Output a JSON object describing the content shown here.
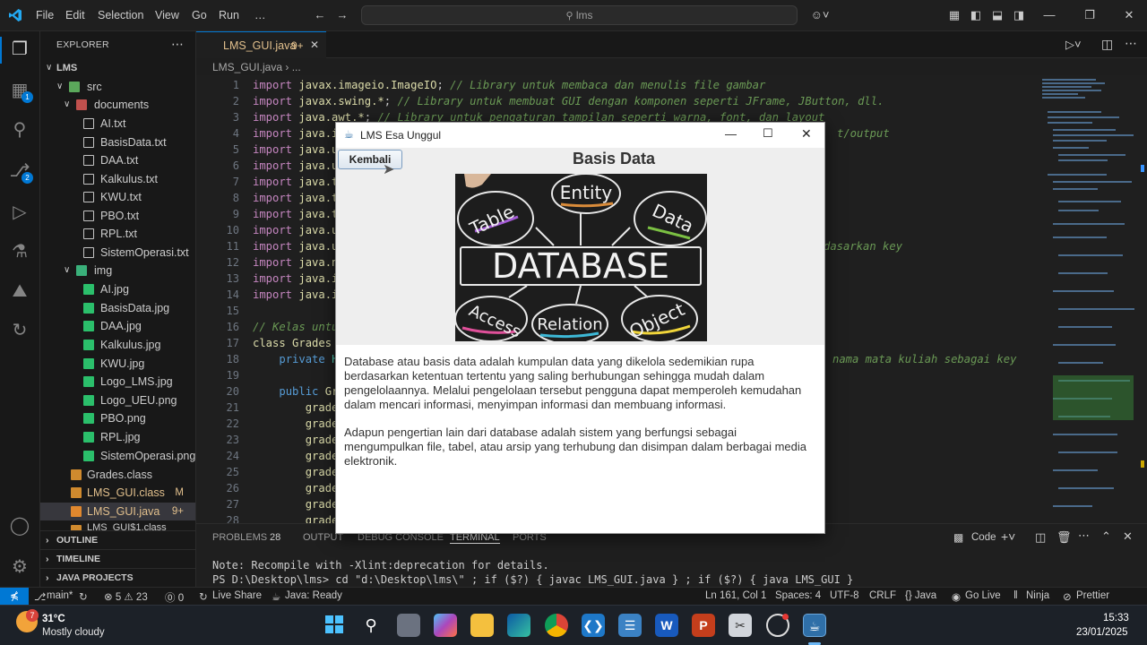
{
  "titlebar": {
    "menu": [
      "File",
      "Edit",
      "Selection",
      "View",
      "Go",
      "Run",
      "…"
    ],
    "search": "lms"
  },
  "sidebar": {
    "title": "EXPLORER",
    "root": "LMS",
    "src": "src",
    "documents": "documents",
    "doc_files": [
      "AI.txt",
      "BasisData.txt",
      "DAA.txt",
      "Kalkulus.txt",
      "KWU.txt",
      "PBO.txt",
      "RPL.txt",
      "SistemOperasi.txt"
    ],
    "img": "img",
    "img_files": [
      "AI.jpg",
      "BasisData.jpg",
      "DAA.jpg",
      "Kalkulus.jpg",
      "KWU.jpg",
      "Logo_LMS.jpg",
      "Logo_UEU.png",
      "PBO.png",
      "RPL.jpg",
      "SistemOperasi.png"
    ],
    "grades_class": "Grades.class",
    "lmsgui_class": "LMS_GUI.class",
    "lmsgui_class_badge": "M",
    "lmsgui_java": "LMS_GUI.java",
    "lmsgui_java_badge": "9+",
    "partial_file": "LMS_GUI$1.class",
    "outline": "OUTLINE",
    "timeline": "TIMELINE",
    "java_projects": "JAVA PROJECTS"
  },
  "activity_badges": {
    "extensions": "1",
    "source_control": "2"
  },
  "tab": {
    "label": "LMS_GUI.java",
    "badge": "9+"
  },
  "breadcrumb": "LMS_GUI.java › ...",
  "code": {
    "c1": "// Library untuk membaca dan menulis file gambar",
    "c2": "// Library untuk membuat GUI dengan komponen seperti JFrame, JButton, dll.",
    "c3": "// Library untuk pengaturan tampilan seperti warna, font, dan layout",
    "c4": "t/output",
    "c10": "dasarkan key",
    "c16": "// Kelas untu",
    "c17": "class Grades",
    "c18": "nama mata kuliah sebagai key",
    "line_numbers": [
      "1",
      "2",
      "3",
      "4",
      "5",
      "6",
      "7",
      "8",
      "9",
      "10",
      "11",
      "12",
      "13",
      "14",
      "15",
      "16",
      "17",
      "18",
      "19",
      "20",
      "21",
      "22",
      "23",
      "24",
      "25",
      "26",
      "27",
      "28"
    ]
  },
  "panel": {
    "tabs": [
      "PROBLEMS",
      "28",
      "OUTPUT",
      "DEBUG CONSOLE",
      "TERMINAL",
      "PORTS"
    ],
    "code_label": "Code",
    "line1": "Note: Recompile with -Xlint:deprecation for details.",
    "line2": "PS D:\\Desktop\\lms> cd \"d:\\Desktop\\lms\\\" ; if ($?) { javac LMS_GUI.java } ; if ($?) { java LMS_GUI }"
  },
  "statusbar": {
    "branch": "main*",
    "errors": "⊗ 5 ⚠ 23",
    "ports": "⓪ 0",
    "liveshare": "Live Share",
    "java": "Java: Ready",
    "position": "Ln 161, Col 1",
    "spaces": "Spaces: 4",
    "encoding": "UTF-8",
    "eol": "CRLF",
    "language": "{} Java",
    "golive": "Go Live",
    "ninja": "Ninja",
    "prettier": "Prettier"
  },
  "taskbar": {
    "weather_badge": "7",
    "temp": "31°C",
    "condition": "Mostly cloudy",
    "time": "15:33",
    "date": "23/01/2025"
  },
  "swing": {
    "title": "LMS Esa Unggul",
    "back_button": "Kembali",
    "heading": "Basis Data",
    "image_words": {
      "main": "DATABASE",
      "top": "Entity",
      "top_left": "Table",
      "top_right": "Data",
      "bottom_left": "Access",
      "bottom_mid": "Relation",
      "bottom_right": "Object"
    },
    "para1": "Database atau basis data adalah kumpulan data yang dikelola sedemikian rupa berdasarkan ketentuan tertentu yang saling berhubungan sehingga mudah dalam pengelolaannya. Melalui pengelolaan tersebut pengguna dapat memperoleh kemudahan dalam mencari informasi, menyimpan informasi dan membuang informasi.",
    "para2": "Adapun pengertian lain dari database adalah sistem yang berfungsi sebagai mengumpulkan file, tabel, atau arsip yang terhubung dan disimpan dalam berbagai media elektronik."
  },
  "colors": {
    "accent": "#0078d4",
    "editor_bg": "#1f1f1f",
    "keyword": "#569cd6",
    "comment": "#6a9955",
    "modified": "#e2c08d"
  }
}
